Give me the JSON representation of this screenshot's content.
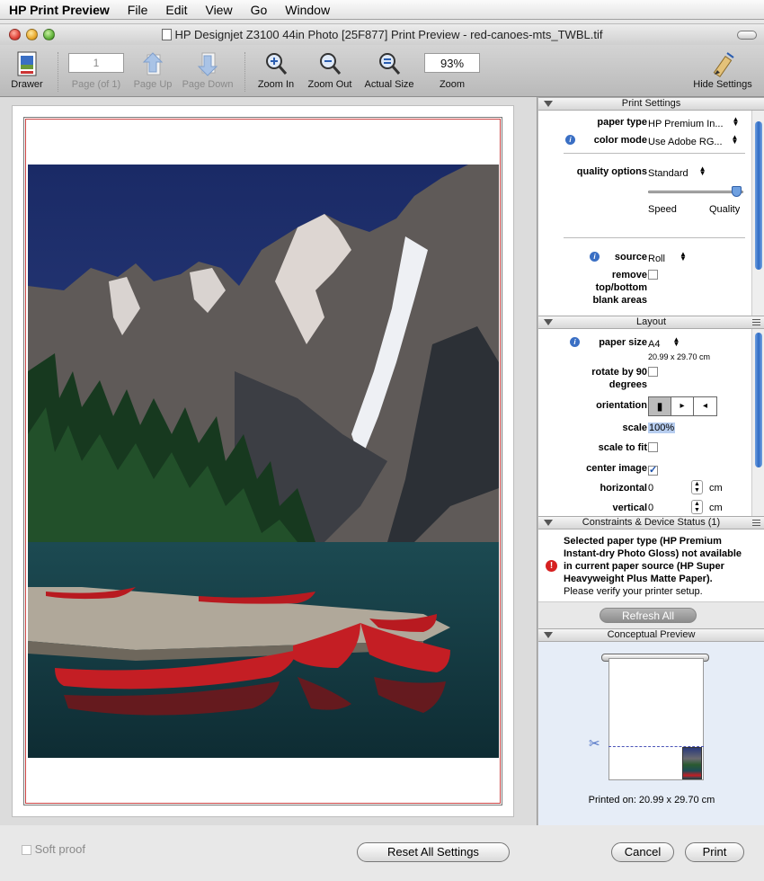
{
  "menubar": {
    "app": "HP Print Preview",
    "items": [
      "File",
      "Edit",
      "View",
      "Go",
      "Window"
    ]
  },
  "window": {
    "title": "HP Designjet Z3100 44in Photo [25F877] Print Preview - red-canoes-mts_TWBL.tif"
  },
  "toolbar": {
    "drawer": "Drawer",
    "page_value": "1",
    "page_label": "Page (of 1)",
    "page_up": "Page Up",
    "page_down": "Page Down",
    "zoom_in": "Zoom In",
    "zoom_out": "Zoom Out",
    "actual_size": "Actual Size",
    "zoom_value": "93%",
    "zoom_label": "Zoom",
    "hide_settings": "Hide Settings"
  },
  "print_settings": {
    "header": "Print Settings",
    "paper_type_label": "paper type",
    "paper_type": "HP Premium In...",
    "color_mode_label": "color mode",
    "color_mode": "Use Adobe RG...",
    "quality_label": "quality options",
    "quality": "Standard",
    "speed": "Speed",
    "quality_end": "Quality",
    "quality_level": 1.0,
    "source_label": "source",
    "source": "Roll",
    "remove_label_1": "remove",
    "remove_label_2": "top/bottom",
    "remove_label_3": "blank areas"
  },
  "layout": {
    "header": "Layout",
    "paper_size_label": "paper size",
    "paper_size": "A4",
    "paper_dims": "20.99 x 29.70 cm",
    "rotate_label_1": "rotate by 90",
    "rotate_label_2": "degrees",
    "orientation_label": "orientation",
    "scale_label": "scale",
    "scale": "100%",
    "scale_fit_label": "scale to fit",
    "center_label": "center image",
    "horizontal_label": "horizontal",
    "horizontal": "0",
    "h_unit": "cm",
    "vertical_label": "vertical",
    "vertical": "0",
    "v_unit": "cm"
  },
  "constraints": {
    "header": "Constraints & Device Status (1)",
    "msg_1": "Selected paper type (HP Premium",
    "msg_2": "Instant-dry Photo Gloss) not available",
    "msg_3": "in current paper source (HP Super",
    "msg_4": "Heavyweight Plus Matte Paper).",
    "msg_5": "Please verify your printer setup.",
    "refresh": "Refresh All"
  },
  "conceptual": {
    "header": "Conceptual Preview",
    "printed_on": "Printed on: 20.99 x 29.70 cm"
  },
  "bottom": {
    "soft_proof": "Soft proof",
    "reset": "Reset All Settings",
    "cancel": "Cancel",
    "print": "Print"
  },
  "colors": {
    "accent": "#3a6fc4",
    "canoe": "#c41e24",
    "warning": "#d62020"
  }
}
